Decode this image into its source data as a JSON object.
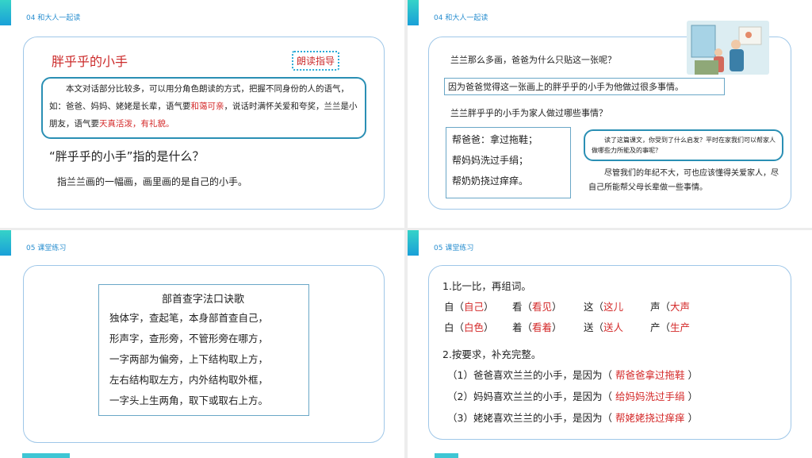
{
  "slide1": {
    "header": "04 和大人一起读",
    "title": "胖乎乎的小手",
    "tag": "朗读指导",
    "para": {
      "p1": "本文对话部分比较多，可以用分角色朗读的方式，把握不同身份的人的语气，如：爸爸、妈妈、姥姥是长辈，语气要",
      "r1": "和蔼可亲",
      "p2": "，说话时满怀关爱和夸奖，兰兰是小朋友，语气要",
      "r2": "天真活泼，有礼貌。"
    },
    "question": "“胖乎乎的小手”指的是什么？",
    "answer": "指兰兰画的一幅画，画里画的是自己的小手。"
  },
  "slide2": {
    "header": "04 和大人一起读",
    "q1": "兰兰那么多画，爸爸为什么只贴这一张呢？",
    "a1": "因为爸爸觉得这一张画上的胖乎乎的小手为他做过很多事情。",
    "q2": "兰兰胖乎乎的小手为家人做过哪些事情？",
    "list": [
      "帮爸爸：拿过拖鞋；",
      "帮妈妈洗过手绢；",
      "帮奶奶挠过痒痒。"
    ],
    "hint": "读了这篇课文，你受到了什么启发？平时在家我们可以帮家人做哪些力所能及的事呢？",
    "hint_answer": "尽管我们的年纪不大，可也应该懂得关爱家人，尽自己所能帮父母长辈做一些事情。"
  },
  "slide3": {
    "header": "05 课堂练习",
    "rhyme_title": "部首查字法口诀歌",
    "rhyme": [
      "独体字，查起笔，本身部首查自己，",
      "形声字，查形旁，不管形旁在哪方，",
      "一字两部为偏旁，上下结构取上方，",
      "左右结构取左方，内外结构取外框，",
      "一字头上生两角，取下或取右上方。"
    ]
  },
  "slide4": {
    "header": "05 课堂练习",
    "s1_title": "1.比一比，再组词。",
    "words": [
      {
        "c": "自",
        "a": "自己"
      },
      {
        "c": "看",
        "a": "看见"
      },
      {
        "c": "这",
        "a": "这儿"
      },
      {
        "c": "声",
        "a": "大声"
      },
      {
        "c": "白",
        "a": "白色"
      },
      {
        "c": "着",
        "a": "看着"
      },
      {
        "c": "送",
        "a": "送人"
      },
      {
        "c": "产",
        "a": "生产"
      }
    ],
    "s2_title": "2.按要求，补充完整。",
    "items": [
      {
        "q": "（1）爸爸喜欢兰兰的小手，是因为（",
        "a": "帮爸爸拿过拖鞋",
        "e": "）"
      },
      {
        "q": "（2）妈妈喜欢兰兰的小手，是因为（",
        "a": "给妈妈洗过手绢",
        "e": "）"
      },
      {
        "q": "（3）姥姥喜欢兰兰的小手，是因为（",
        "a": "帮姥姥挠过痒痒",
        "e": "）"
      }
    ]
  }
}
